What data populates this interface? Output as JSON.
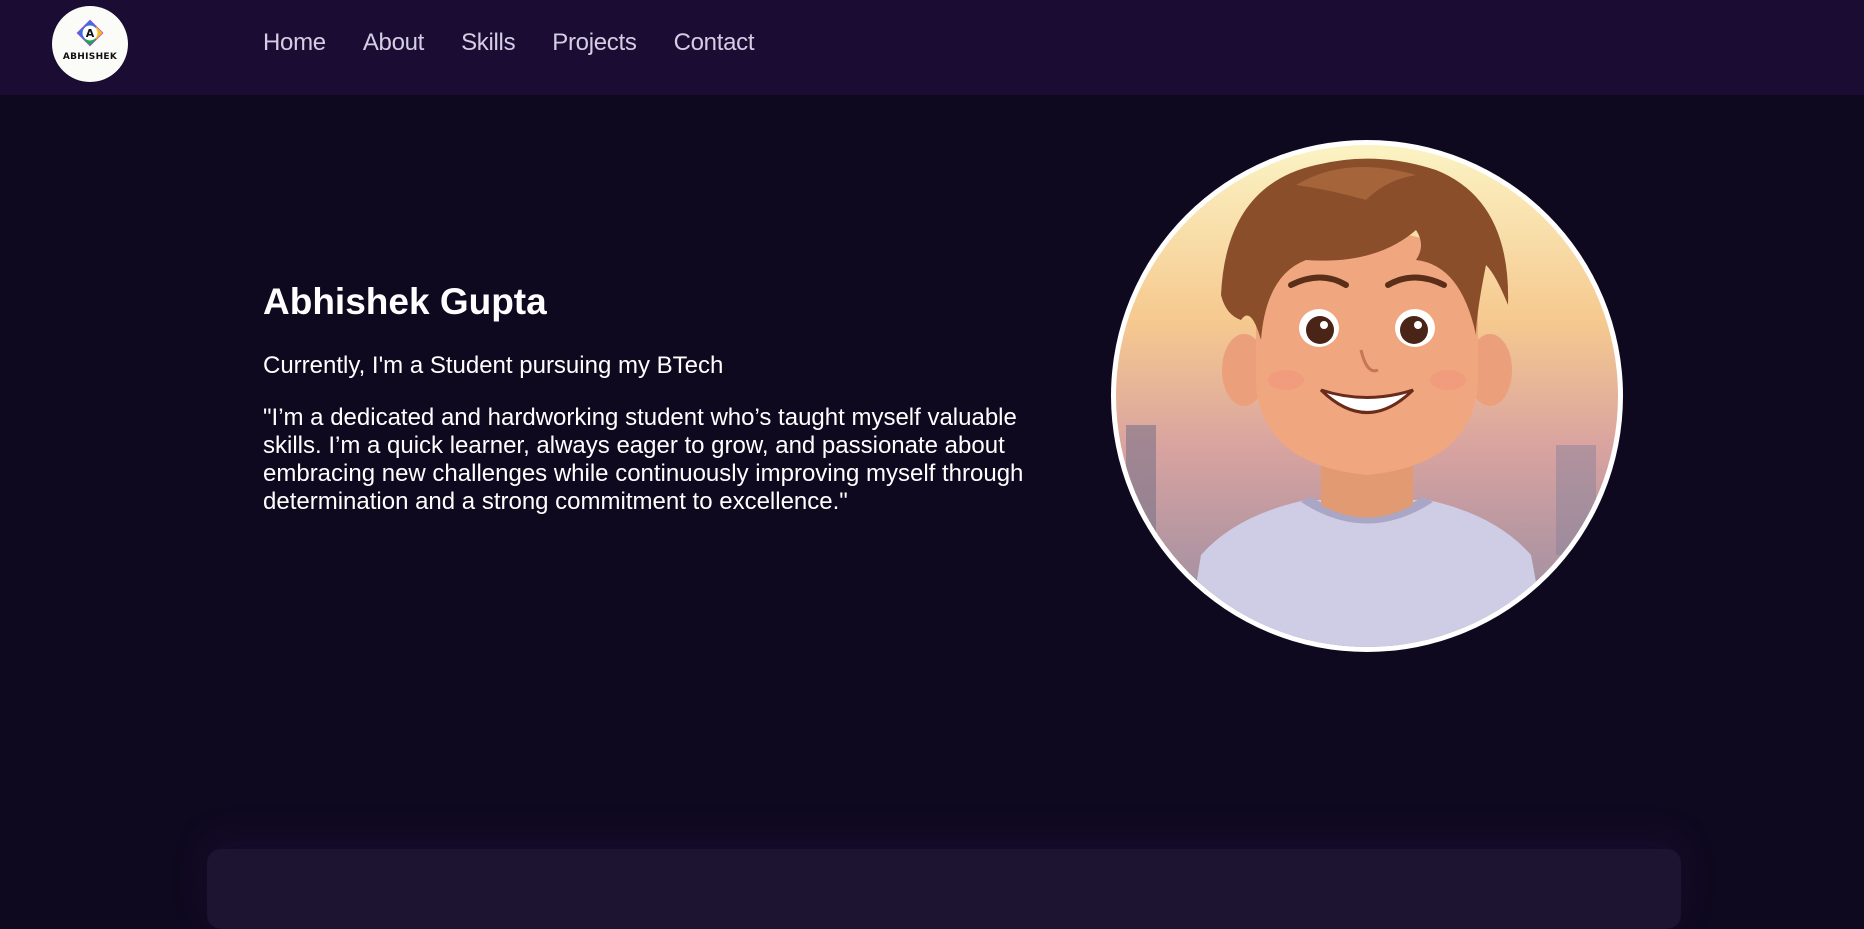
{
  "logo": {
    "letter": "A",
    "text": "ABHISHEK"
  },
  "nav": {
    "items": [
      {
        "label": "Home"
      },
      {
        "label": "About"
      },
      {
        "label": "Skills"
      },
      {
        "label": "Projects"
      },
      {
        "label": "Contact"
      }
    ]
  },
  "hero": {
    "name": "Abhishek Gupta",
    "subtitle": "Currently, I'm a Student pursuing my BTech",
    "quote": "\"I’m a dedicated and hardworking student who’s taught myself valuable skills. I’m a quick learner, always eager to grow, and passionate about embracing new challenges while continuously improving myself through determination and a strong commitment to excellence.\""
  },
  "colors": {
    "page_background": "#0f0920",
    "navbar_background": "#1b0c33",
    "nav_text": "#d4cde4",
    "card_background": "#1c1430"
  },
  "icons": {
    "logo": "abhishek-logo-icon",
    "avatar": "cartoon-boy-avatar"
  }
}
